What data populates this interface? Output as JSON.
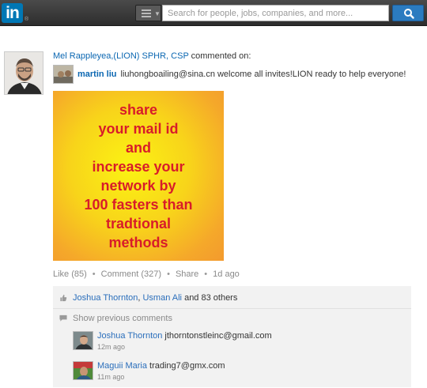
{
  "header": {
    "logo_text": "in",
    "logo_reg": "®",
    "search_placeholder": "Search for people, jobs, companies, and more...",
    "brand_color": "#0077b5"
  },
  "post": {
    "actor_name": "Mel Rappleyea,(LION) SPHR, CSP",
    "action_text": "commented on:",
    "commenter_name": "martin liu",
    "comment_text": "liuhongboailing@sina.cn welcome all invites!LION ready to help everyone!",
    "image_text": "share\nyour mail id\nand\nincrease your\nnetwork by\n100 fasters than\ntradtional\nmethods",
    "actions": {
      "like": "Like (85)",
      "comment": "Comment (327)",
      "share": "Share",
      "time": "1d ago",
      "separator": "•"
    }
  },
  "social": {
    "liker_1": "Joshua Thornton",
    "liker_sep": ", ",
    "liker_2": "Usman Ali",
    "likes_suffix": " and 83 others",
    "show_previous": "Show previous comments",
    "replies": [
      {
        "author": "Joshua Thornton",
        "text": "jthorntonstleinc@gmail.com",
        "time": "12m ago"
      },
      {
        "author": "Maguii Maria",
        "text": "trading7@gmx.com",
        "time": "11m ago"
      }
    ]
  }
}
